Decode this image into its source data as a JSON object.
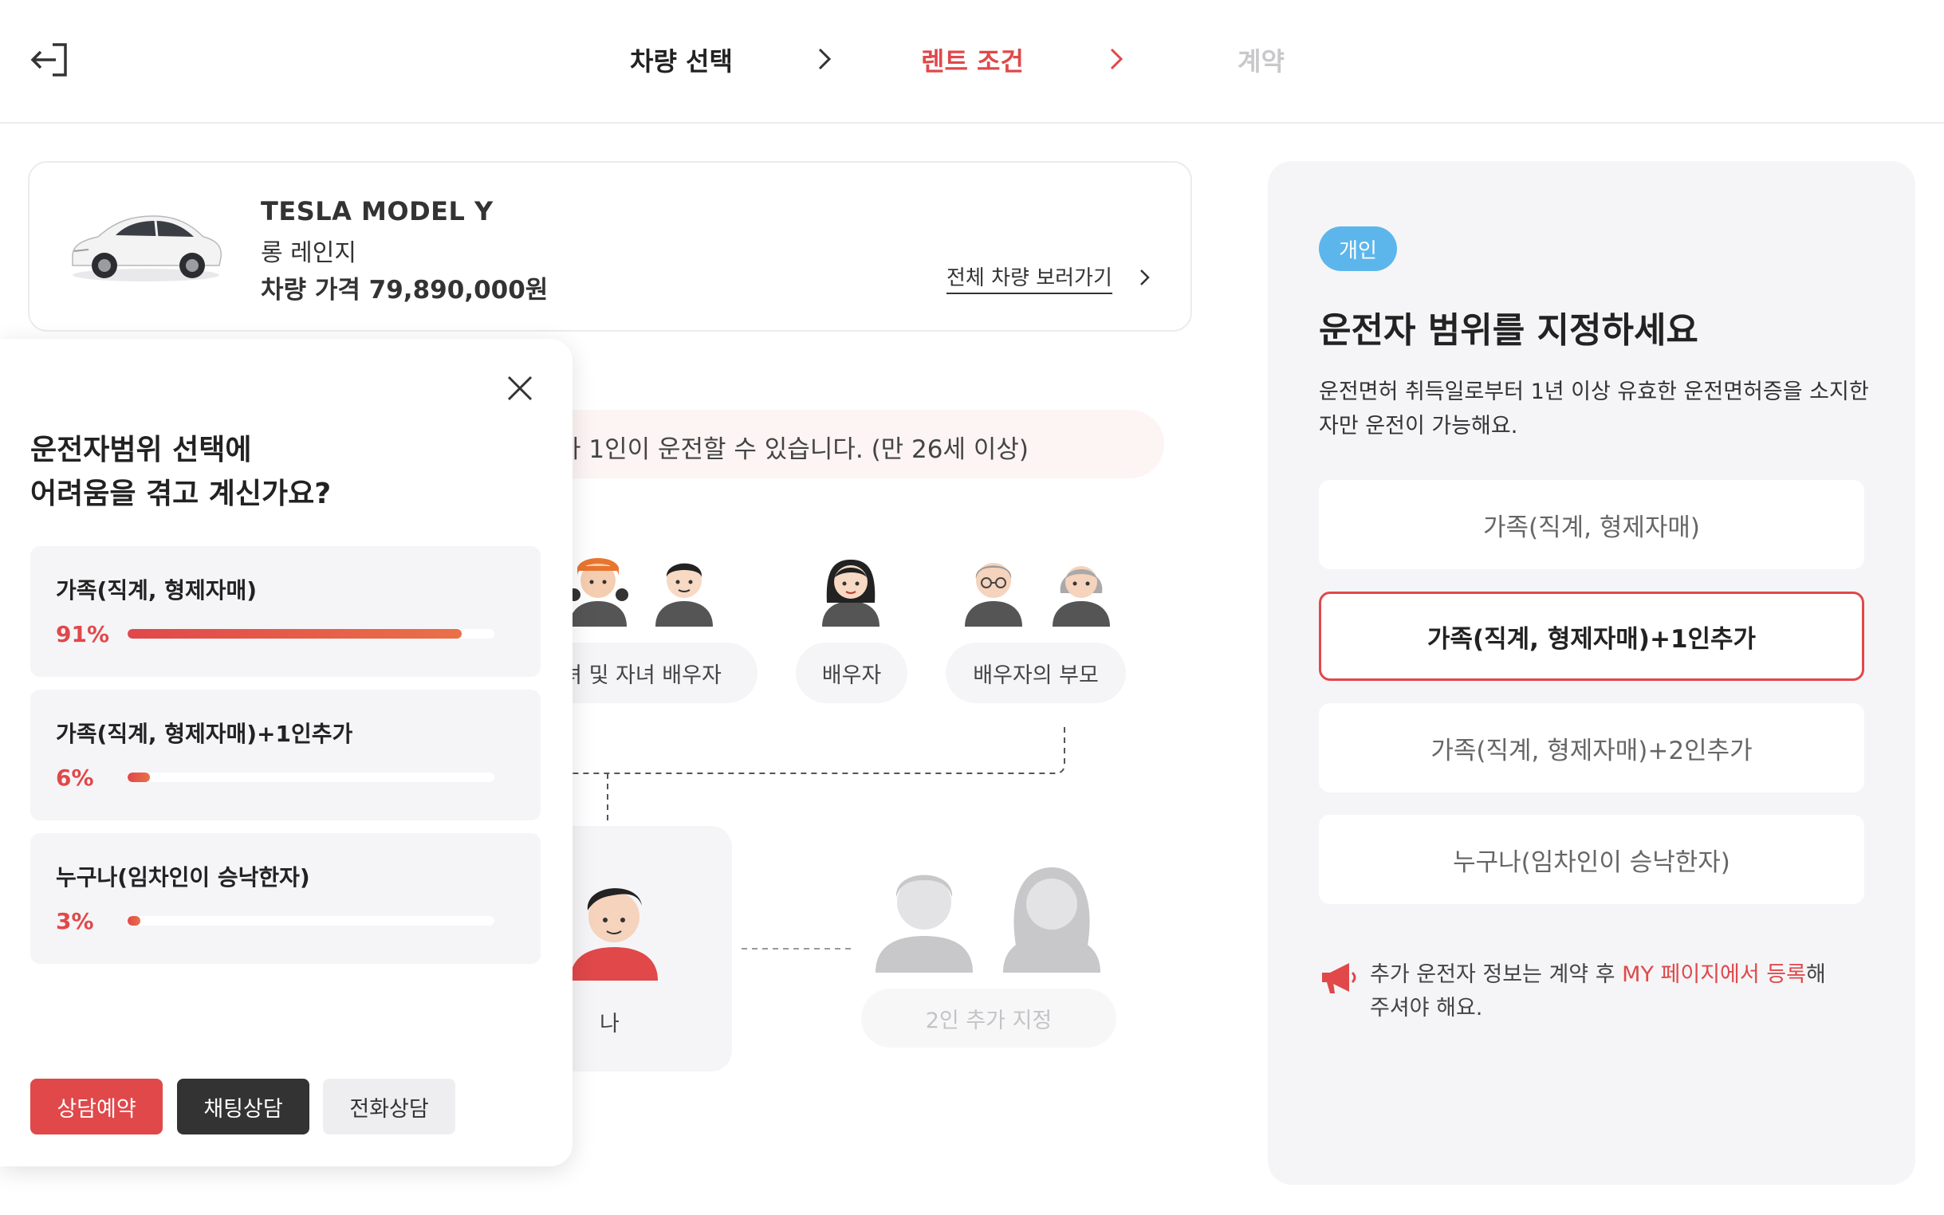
{
  "header": {
    "steps": [
      "차량 선택",
      "렌트 조건",
      "계약"
    ],
    "active_step": "렌트 조건"
  },
  "vehicle": {
    "name": "TESLA MODEL Y",
    "trim": "롱 레인지",
    "price": "차량 가격 79,890,000원",
    "view_all": "전체 차량 보러가기"
  },
  "diagram": {
    "notice": "가 1인이 운전할 수 있습니다. (만 26세 이상)",
    "labels": {
      "children": "녀 및 자녀 배우자",
      "spouse": "배우자",
      "spouse_parents": "배우자의 부모",
      "me": "나",
      "add_two": "2인 추가 지정"
    }
  },
  "popup": {
    "title_line1": "운전자범위 선택에",
    "title_line2": "어려움을 겪고 계신가요?",
    "poll": [
      {
        "label": "가족(직계, 형제자매)",
        "percent_text": "91%",
        "fraction": 0.91
      },
      {
        "label": "가족(직계, 형제자매)+1인추가",
        "percent_text": "6%",
        "fraction": 0.06
      },
      {
        "label": "누구나(임차인이 승낙한자)",
        "percent_text": "3%",
        "fraction": 0.03
      }
    ],
    "buttons": {
      "reserve": "상담예약",
      "chat": "채팅상담",
      "phone": "전화상담"
    }
  },
  "panel": {
    "badge": "개인",
    "title": "운전자 범위를 지정하세요",
    "desc": "운전면허 취득일로부터 1년 이상 유효한 운전면허증을 소지한 자만 운전이 가능해요.",
    "options": [
      "가족(직계, 형제자매)",
      "가족(직계, 형제자매)+1인추가",
      "가족(직계, 형제자매)+2인추가",
      "누구나(임차인이 승낙한자)"
    ],
    "selected_option": "가족(직계, 형제자매)+1인추가",
    "note_prefix": "추가 운전자 정보는 계약 후 ",
    "note_link": "MY 페이지에서 등록",
    "note_suffix": "해주셔야 해요."
  },
  "colors": {
    "accent": "#e0484a",
    "badge": "#5cb6ec",
    "panel_bg": "#f5f5f7",
    "dark_button": "#333333"
  },
  "icons": {
    "exit": "exit-icon",
    "chevron": "chevron-right-icon",
    "close": "close-icon",
    "megaphone": "megaphone-icon"
  }
}
